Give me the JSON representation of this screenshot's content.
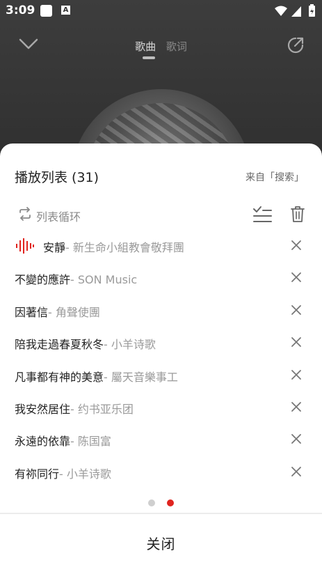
{
  "status_bar": {
    "time": "3:09",
    "a_icon_text": "A"
  },
  "player": {
    "tabs": [
      "歌曲",
      "歌词"
    ]
  },
  "playlist": {
    "title": "播放列表 (31)",
    "source": "来自「搜索」",
    "loop_mode_label": "列表循环",
    "songs": [
      {
        "title": "安靜",
        "artist": "- 新生命小組教會敬拜團",
        "playing": true
      },
      {
        "title": "不變的應許",
        "artist": "- SON Music",
        "playing": false
      },
      {
        "title": "因著信",
        "artist": "- 角聲使團",
        "playing": false
      },
      {
        "title": "陪我走過春夏秋冬",
        "artist": "- 小羊诗歌",
        "playing": false
      },
      {
        "title": "凡事都有神的美意",
        "artist": "- 屬天音樂事工",
        "playing": false
      },
      {
        "title": "我安然居住",
        "artist": "- 约书亚乐团",
        "playing": false
      },
      {
        "title": "永遠的依靠",
        "artist": "- 陈国富",
        "playing": false
      },
      {
        "title": "有祢同行",
        "artist": "- 小羊诗歌",
        "playing": false
      }
    ],
    "page_indicator": {
      "pages": 2,
      "current": 2
    },
    "close_label": "关闭"
  },
  "colors": {
    "accent": "#e0241f",
    "artist_gray": "#9a9a9a"
  }
}
